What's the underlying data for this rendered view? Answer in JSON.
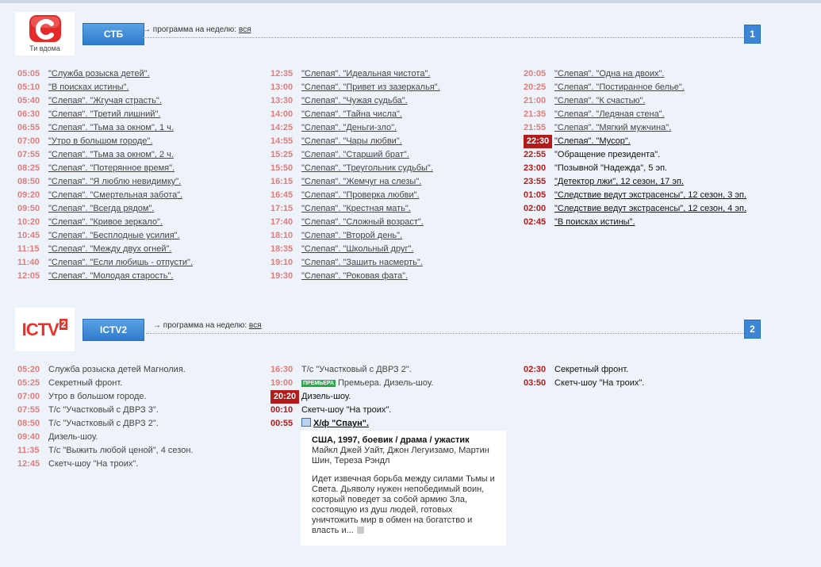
{
  "channels": [
    {
      "name": "СТБ",
      "logo_text": "Ти вдома",
      "week_prefix": "→ программа на неделю:",
      "week_link": "вся",
      "number": "1",
      "columns": [
        [
          {
            "time": "05:05",
            "title": "\"Служба розыска детей\".",
            "state": "past",
            "link": true
          },
          {
            "time": "05:10",
            "title": "\"В поисках истины\".",
            "state": "past",
            "link": true
          },
          {
            "time": "05:40",
            "title": "\"Слепая\". \"Жгучая страсть\".",
            "state": "past",
            "link": true
          },
          {
            "time": "06:30",
            "title": "\"Слепая\". \"Третий лишний\".",
            "state": "past",
            "link": true
          },
          {
            "time": "06:55",
            "title": "\"Слепая\". \"Тьма за окном\", 1 ч.",
            "state": "past",
            "link": true
          },
          {
            "time": "07:00",
            "title": "\"Утро в большом городе\".",
            "state": "past",
            "link": true
          },
          {
            "time": "07:55",
            "title": "\"Слепая\". \"Тьма за окном\", 2 ч.",
            "state": "past",
            "link": true
          },
          {
            "time": "08:25",
            "title": "\"Слепая\". \"Потерянное время\".",
            "state": "past",
            "link": true
          },
          {
            "time": "08:50",
            "title": "\"Слепая\". \"Я люблю невидимку\".",
            "state": "past",
            "link": true
          },
          {
            "time": "09:20",
            "title": "\"Слепая\". \"Смертельная забота\".",
            "state": "past",
            "link": true
          },
          {
            "time": "09:50",
            "title": "\"Слепая\". \"Всегда рядом\".",
            "state": "past",
            "link": true
          },
          {
            "time": "10:20",
            "title": "\"Слепая\". \"Кривое зеркало\".",
            "state": "past",
            "link": true
          },
          {
            "time": "10:45",
            "title": "\"Слепая\". \"Бесплодные усилия\".",
            "state": "past",
            "link": true
          },
          {
            "time": "11:15",
            "title": "\"Слепая\". \"Между двух огней\".",
            "state": "past",
            "link": true
          },
          {
            "time": "11:40",
            "title": "\"Слепая\". \"Если любишь - отпусти\".",
            "state": "past",
            "link": true
          },
          {
            "time": "12:05",
            "title": "\"Слепая\". \"Молодая старость\".",
            "state": "past",
            "link": true
          }
        ],
        [
          {
            "time": "12:35",
            "title": "\"Слепая\". \"Идеальная чистота\".",
            "state": "past",
            "link": true
          },
          {
            "time": "13:00",
            "title": "\"Слепая\". \"Привет из зазеркалья\".",
            "state": "past",
            "link": true
          },
          {
            "time": "13:30",
            "title": "\"Слепая\". \"Чужая судьба\".",
            "state": "past",
            "link": true
          },
          {
            "time": "14:00",
            "title": "\"Слепая\". \"Тайна числа\".",
            "state": "past",
            "link": true
          },
          {
            "time": "14:25",
            "title": "\"Слепая\". \"Деньги-зло\".",
            "state": "past",
            "link": true
          },
          {
            "time": "14:55",
            "title": "\"Слепая\". \"Чары любви\".",
            "state": "past",
            "link": true
          },
          {
            "time": "15:25",
            "title": "\"Слепая\". \"Старший брат\".",
            "state": "past",
            "link": true
          },
          {
            "time": "15:50",
            "title": "\"Слепая\". \"Треугольник судьбы\".",
            "state": "past",
            "link": true
          },
          {
            "time": "16:15",
            "title": "\"Слепая\". \"Жемчуг на слезы\".",
            "state": "past",
            "link": true
          },
          {
            "time": "16:45",
            "title": "\"Слепая\". \"Проверка любви\".",
            "state": "past",
            "link": true
          },
          {
            "time": "17:15",
            "title": "\"Слепая\". \"Крестная мать\".",
            "state": "past",
            "link": true
          },
          {
            "time": "17:40",
            "title": "\"Слепая\". \"Сложный возраст\".",
            "state": "past",
            "link": true
          },
          {
            "time": "18:10",
            "title": "\"Слепая\". \"Второй день\".",
            "state": "past",
            "link": true
          },
          {
            "time": "18:35",
            "title": "\"Слепая\". \"Школьный друг\".",
            "state": "past",
            "link": true
          },
          {
            "time": "19:10",
            "title": "\"Слепая\". \"Зашить насмерть\".",
            "state": "past",
            "link": true
          },
          {
            "time": "19:30",
            "title": "\"Слепая\". \"Роковая фата\".",
            "state": "past",
            "link": true
          }
        ],
        [
          {
            "time": "20:05",
            "title": "\"Слепая\". \"Одна на двоих\".",
            "state": "past",
            "link": true
          },
          {
            "time": "20:25",
            "title": "\"Слепая\". \"Постиранное белье\".",
            "state": "past",
            "link": true
          },
          {
            "time": "21:00",
            "title": "\"Слепая\". \"К счастью\".",
            "state": "past",
            "link": true
          },
          {
            "time": "21:35",
            "title": "\"Слепая\". \"Ледяная стена\".",
            "state": "past",
            "link": true
          },
          {
            "time": "21:55",
            "title": "\"Слепая\". \"Мягкий мужчина\".",
            "state": "past",
            "link": true
          },
          {
            "time": "22:30",
            "title": "\"Слепая\". \"Мусор\".",
            "state": "now",
            "link": true
          },
          {
            "time": "22:55",
            "title": "\"Обращение президента\".",
            "state": "future",
            "link": false
          },
          {
            "time": "23:00",
            "title": "\"Позывной \"Надежда\", 5 эп.",
            "state": "future",
            "link": false
          },
          {
            "time": "23:55",
            "title": "\"Детектор лжи\", 12 сезон, 17 эп.",
            "state": "future",
            "link": true
          },
          {
            "time": "01:05",
            "title": "\"Следствие ведут экстрасенсы\", 12 сезон, 3 эп.",
            "state": "future",
            "link": true
          },
          {
            "time": "02:00",
            "title": "\"Следствие ведут экстрасенсы\", 12 сезон, 4 эп.",
            "state": "future",
            "link": true
          },
          {
            "time": "02:45",
            "title": "\"В поисках истины\".",
            "state": "future",
            "link": true
          }
        ]
      ]
    },
    {
      "name": "ICTV2",
      "logo_text": "ICTV",
      "logo_sup": "2",
      "week_prefix": "→ программа на неделю:",
      "week_link": "вся",
      "number": "2",
      "columns": [
        [
          {
            "time": "05:20",
            "title": "Служба розыска детей Магнолия.",
            "state": "past",
            "link": false
          },
          {
            "time": "05:25",
            "title": "Секретный фронт.",
            "state": "past",
            "link": false
          },
          {
            "time": "07:00",
            "title": "Утро в большом городе.",
            "state": "past",
            "link": false
          },
          {
            "time": "07:55",
            "title": "Т/с \"Участковый с ДВРЗ 3\".",
            "state": "past",
            "link": false
          },
          {
            "time": "08:50",
            "title": "Т/с \"Участковый с ДВРЗ 2\".",
            "state": "past",
            "link": false
          },
          {
            "time": "09:40",
            "title": "Дизель-шоу.",
            "state": "past",
            "link": false
          },
          {
            "time": "11:35",
            "title": "Т/с \"Выжить любой ценой\", 4 сезон.",
            "state": "past",
            "link": false
          },
          {
            "time": "12:45",
            "title": "Скетч-шоу \"На троих\".",
            "state": "past",
            "link": false
          }
        ],
        [
          {
            "time": "16:30",
            "title": "Т/с \"Участковый с ДВРЗ 2\".",
            "state": "past",
            "link": false
          },
          {
            "time": "19:00",
            "title": "Премьера. Дизель-шоу.",
            "state": "past",
            "link": false,
            "badge": "ПРЕМЬЕРА"
          },
          {
            "time": "20:20",
            "title": "Дизель-шоу.",
            "state": "now",
            "link": false
          },
          {
            "time": "00:10",
            "title": "Скетч-шоу \"На троих\".",
            "state": "future",
            "link": false
          },
          {
            "time": "00:55",
            "title": "Х/ф \"Спаун\".",
            "state": "future",
            "link": true,
            "film": true
          }
        ],
        [
          {
            "time": "02:30",
            "title": "Секретный фронт.",
            "state": "future",
            "link": false
          },
          {
            "time": "03:50",
            "title": "Скетч-шоу \"На троих\".",
            "state": "future",
            "link": false
          }
        ]
      ]
    }
  ],
  "popup": {
    "head": "США, 1997, боевик / драма / ужастик",
    "cast": "Майкл Джей Уайт, Джон Легуизамо, Мартин Шин, Тереза Рэндл",
    "desc": "Идет извечная борьба между силами Тьмы и Света. Дьяволу нужен непобедимый воин, который поведет за собой армию Зла, состоящую из душ людей, готовых уничтожить мир в обмен на богатство и власть и..."
  }
}
